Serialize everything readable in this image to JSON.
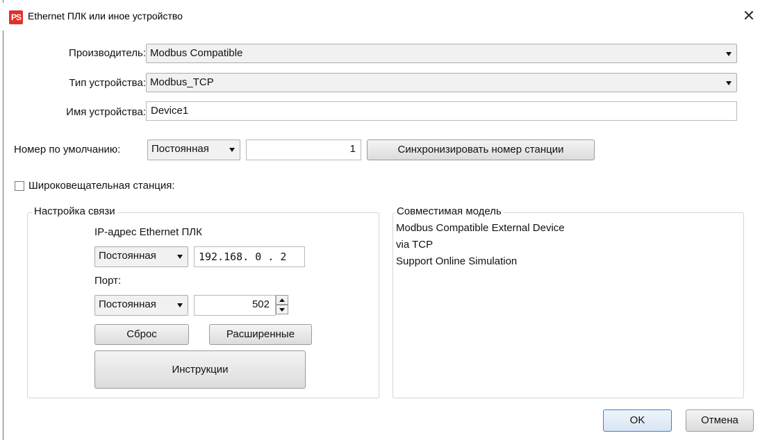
{
  "window": {
    "title": "Ethernet ПЛК или иное устройство",
    "app_icon_text": "PS",
    "close_symbol": "✕"
  },
  "form": {
    "manufacturer_label": "Производитель:",
    "manufacturer_value": "Modbus Compatible",
    "device_type_label": "Тип устройства:",
    "device_type_value": "Modbus_TCP",
    "device_name_label": "Имя устройства:",
    "device_name_value": "Device1",
    "default_number_label": "Номер по умолчанию:",
    "default_number_mode": "Постоянная",
    "default_number_value": "1",
    "sync_button": "Синхронизировать номер станции",
    "broadcast_label": "Широковещательная станция:",
    "broadcast_checked": false
  },
  "connection": {
    "group_title": "Настройка связи",
    "ip_label": "IP-адрес Ethernet ПЛК",
    "ip_mode": "Постоянная",
    "ip_value": "192.168. 0 . 2",
    "port_label": "Порт:",
    "port_mode": "Постоянная",
    "port_value": "502",
    "reset_button": "Сброс",
    "advanced_button": "Расширенные",
    "instructions_button": "Инструкции"
  },
  "compatible": {
    "group_title": "Совместимая модель",
    "lines": [
      "Modbus Compatible External Device",
      "via TCP",
      "Support Online Simulation"
    ]
  },
  "footer": {
    "ok_button": "OK",
    "cancel_button": "Отмена"
  },
  "colors": {
    "icon_red": "#e0312a",
    "ok_border": "#3c7fd1"
  }
}
